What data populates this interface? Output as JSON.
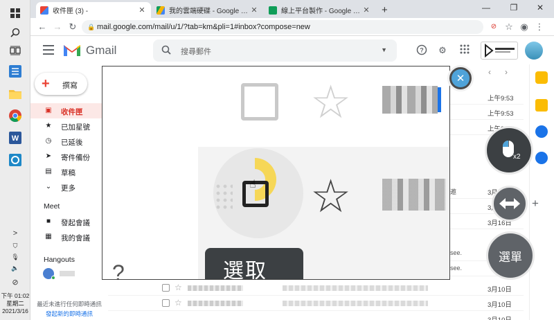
{
  "taskbar": {
    "clock": {
      "time": "下午 01:02",
      "weekday": "星期二",
      "date": "2021/3/16"
    },
    "collapse_glyph": ">"
  },
  "browser": {
    "tabs": [
      {
        "title": "收件匣 (3) - ",
        "active": true,
        "favicon": "gmail-icon"
      },
      {
        "title": "我的雲端硬碟 - Google 雲端硬碟",
        "active": false,
        "favicon": "drive-icon"
      },
      {
        "title": "線上平台製作 - Google 試算表",
        "active": false,
        "favicon": "sheets-icon"
      }
    ],
    "new_tab": "+",
    "url": "mail.google.com/mail/u/1/?tab=km&pli=1#inbox?compose=new",
    "window_controls": [
      "—",
      "❐",
      "✕"
    ]
  },
  "gmail": {
    "brand": "Gmail",
    "search_placeholder": "搜尋郵件",
    "compose_label": "撰寫",
    "nav": [
      {
        "label": "收件匣",
        "icon": "inbox-icon",
        "active": true
      },
      {
        "label": "已加星號",
        "icon": "star-icon",
        "active": false
      },
      {
        "label": "已延後",
        "icon": "clock-icon",
        "active": false
      },
      {
        "label": "寄件備份",
        "icon": "send-icon",
        "active": false
      },
      {
        "label": "草稿",
        "icon": "draft-icon",
        "active": false
      },
      {
        "label": "更多",
        "icon": "chevron-down-icon",
        "active": false
      }
    ],
    "meet": {
      "heading": "Meet",
      "items": [
        {
          "label": "發起會議",
          "icon": "video-icon"
        },
        {
          "label": "我的會議",
          "icon": "calendar-icon"
        }
      ]
    },
    "hangouts": {
      "heading": "Hangouts",
      "user": ""
    },
    "chat_empty": "最近未進行任何即時通訊",
    "chat_start": "發起新的即時通訊",
    "messages": [
      {
        "date": "上午9:53"
      },
      {
        "date": "上午9:53"
      },
      {
        "date": "上午9:53"
      },
      {
        "date": "3月16日"
      },
      {
        "date": "3月16日"
      },
      {
        "date": "3月16日"
      },
      {
        "date": "3月10日"
      },
      {
        "date": "3月10日"
      },
      {
        "date": "3月10日"
      }
    ],
    "snippet_fragments": [
      "邀",
      "see.",
      "see."
    ]
  },
  "magnifier": {
    "tooltip": "選取",
    "bottom_glyph": "?"
  },
  "floating": {
    "close": "✕",
    "double_click_badge": "x2",
    "menu_label": "選單"
  },
  "colors": {
    "gmail_red": "#d93025",
    "chrome_tabstrip": "#dee1e6",
    "cursor_ring": "#f7d547",
    "fab_dark": "#3c4043",
    "close_blue": "#4fa3d9"
  }
}
